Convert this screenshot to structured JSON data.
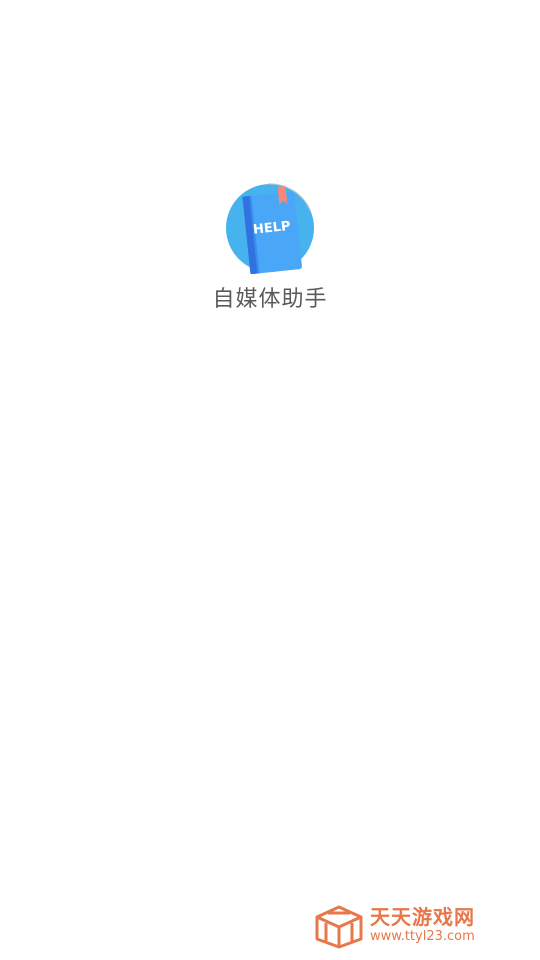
{
  "app": {
    "name": "自媒体助手",
    "logo_icon": "help-book-icon",
    "logo_text": "HELP"
  },
  "watermark": {
    "title": "天天游戏网",
    "url": "www.ttyl23.com",
    "icon": "ttyl-cube-logo-icon"
  },
  "colors": {
    "background": "#ffffff",
    "logo_circle": "#46b3ee",
    "book_cover": "#4aa6f7",
    "book_spine": "#2f72e0",
    "bookmark": "#f08a7a",
    "app_name_text": "#5a5a5a",
    "watermark": "#e8774a"
  }
}
